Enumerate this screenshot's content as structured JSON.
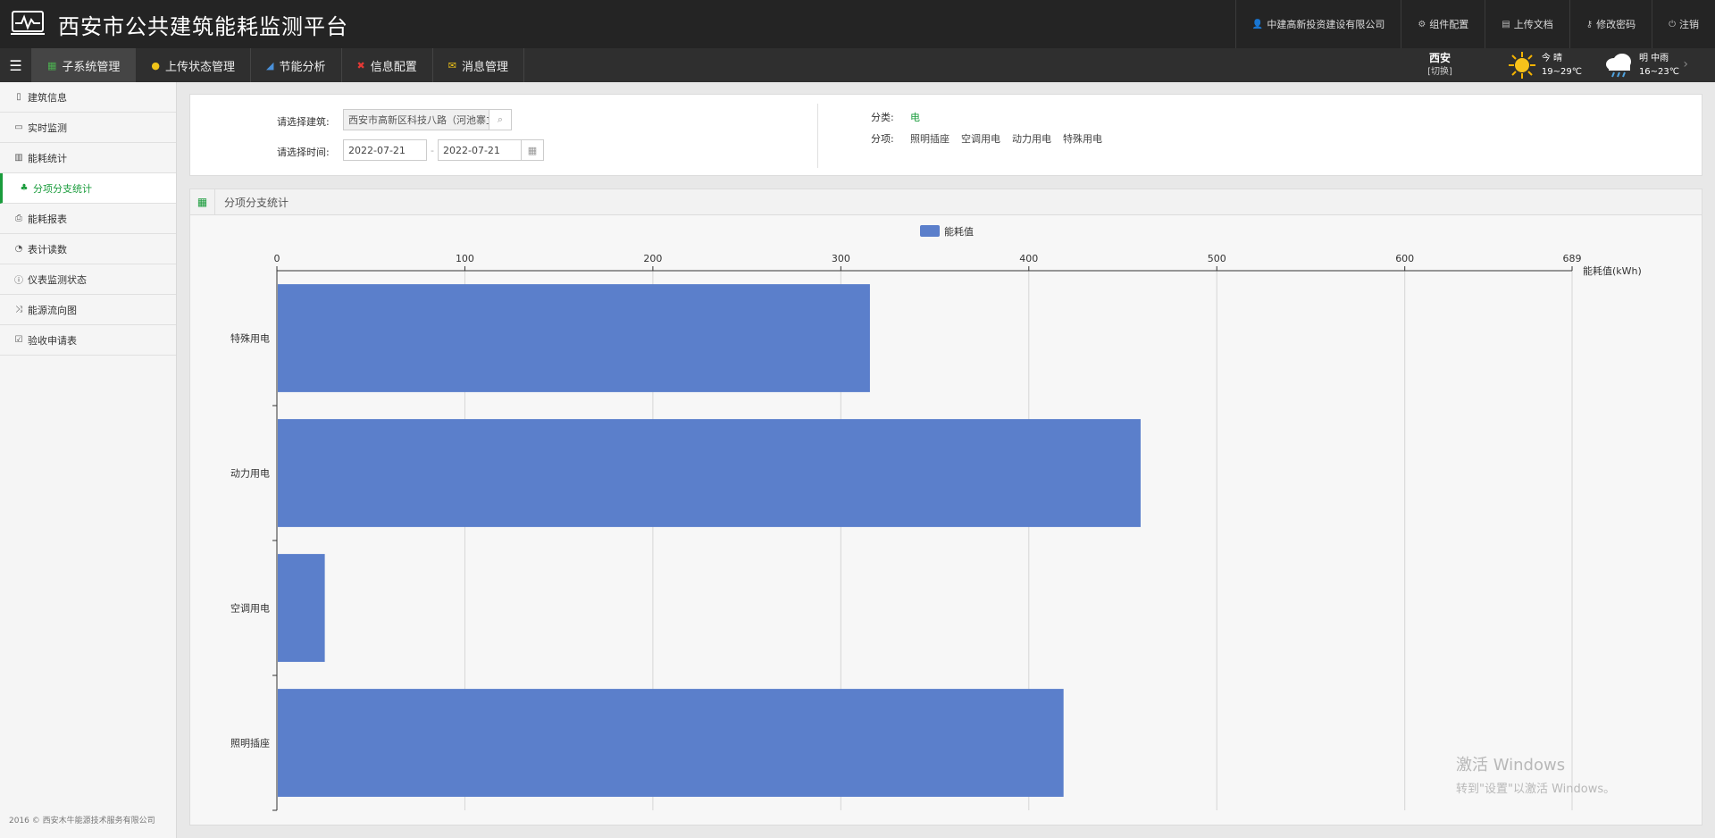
{
  "app": {
    "title": "西安市公共建筑能耗监测平台"
  },
  "topbar": {
    "items": [
      {
        "icon": "user-icon",
        "label": "中建高新投资建设有限公司"
      },
      {
        "icon": "gear-icon",
        "label": "组件配置"
      },
      {
        "icon": "book-icon",
        "label": "上传文档"
      },
      {
        "icon": "key-icon",
        "label": "修改密码"
      },
      {
        "icon": "power-icon",
        "label": "注销"
      }
    ]
  },
  "nav": {
    "tabs": [
      {
        "label": "子系统管理",
        "icon": "grid-icon",
        "active": true
      },
      {
        "label": "上传状态管理",
        "icon": "info-circle-icon"
      },
      {
        "label": "节能分析",
        "icon": "signal-icon"
      },
      {
        "label": "信息配置",
        "icon": "close-circle-icon"
      },
      {
        "label": "消息管理",
        "icon": "envelope-icon"
      }
    ]
  },
  "weather": {
    "city": "西安",
    "switch": "[切换]",
    "today": {
      "label": "今 晴",
      "range": "19~29℃",
      "icon": "sun-icon"
    },
    "tomorrow": {
      "label": "明 中雨",
      "range": "16~23℃",
      "icon": "rain-cloud-icon"
    }
  },
  "sidebar": {
    "items": [
      {
        "label": "建筑信息",
        "icon": "building-icon"
      },
      {
        "label": "实时监测",
        "icon": "laptop-icon"
      },
      {
        "label": "能耗统计",
        "icon": "bar-chart-icon"
      },
      {
        "label": "分项分支统计",
        "icon": "sitemap-icon",
        "active": true
      },
      {
        "label": "能耗报表",
        "icon": "print-icon"
      },
      {
        "label": "表计读数",
        "icon": "dashboard-icon"
      },
      {
        "label": "仪表监测状态",
        "icon": "info-icon"
      },
      {
        "label": "能源流向图",
        "icon": "random-icon"
      },
      {
        "label": "验收申请表",
        "icon": "check-square-icon"
      }
    ],
    "copyright": "2016 © 西安木牛能源技术服务有限公司"
  },
  "filter": {
    "building_label": "请选择建筑:",
    "building_value": "西安市高新区科技八路（河池寨立交-高新",
    "time_label": "请选择时间:",
    "date_from": "2022-07-21",
    "date_sep": "-",
    "date_to": "2022-07-21",
    "category_label": "分类:",
    "category_value": "电",
    "subitem_label": "分项:",
    "subitems": [
      "照明插座",
      "空调用电",
      "动力用电",
      "特殊用电"
    ]
  },
  "panel": {
    "title": "分项分支统计"
  },
  "chart_data": {
    "type": "bar",
    "orientation": "horizontal",
    "categories": [
      "特殊用电",
      "动力用电",
      "空调用电",
      "照明插座"
    ],
    "series": [
      {
        "name": "能耗值",
        "values": [
          315,
          459,
          25,
          418
        ],
        "color": "#5b7fcb"
      }
    ],
    "xlabel": "能耗值(kWh)",
    "xlim": [
      0,
      689
    ],
    "xticks": [
      0,
      100,
      200,
      300,
      400,
      500,
      600,
      689
    ],
    "legend_position": "top-center",
    "grid": true
  },
  "watermark": {
    "line1": "激活 Windows",
    "line2": "转到\"设置\"以激活 Windows。"
  }
}
